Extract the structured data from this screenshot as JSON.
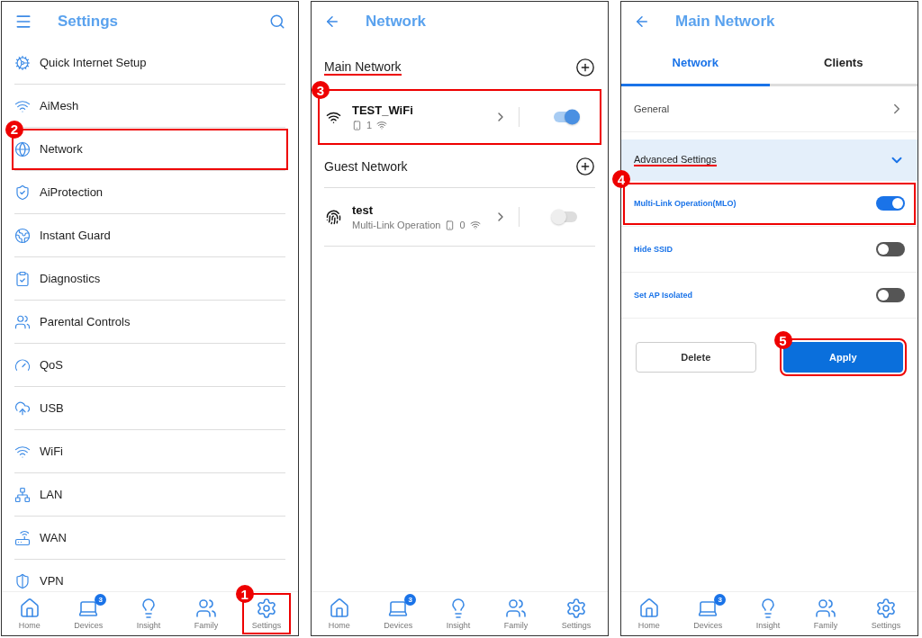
{
  "screens": [
    {
      "kind": "menu",
      "title": "Settings",
      "items": [
        {
          "label": "Quick Internet Setup"
        },
        {
          "label": "AiMesh"
        },
        {
          "label": "Network",
          "callout": "2"
        },
        {
          "label": "AiProtection"
        },
        {
          "label": "Instant Guard"
        },
        {
          "label": "Diagnostics"
        },
        {
          "label": "Parental Controls"
        },
        {
          "label": "QoS"
        },
        {
          "label": "USB"
        },
        {
          "label": "WiFi"
        },
        {
          "label": "LAN"
        },
        {
          "label": "WAN"
        },
        {
          "label": "VPN"
        }
      ],
      "nav": [
        {
          "label": "Home"
        },
        {
          "label": "Devices",
          "badge": "3"
        },
        {
          "label": "Insight"
        },
        {
          "label": "Family"
        },
        {
          "label": "Settings",
          "callout": "1"
        }
      ]
    },
    {
      "kind": "networks",
      "title": "Network",
      "sections": [
        {
          "title": "Main Network",
          "underlined": true,
          "networks": [
            {
              "name": "TEST_WiFi",
              "clients": "1",
              "on": true,
              "callout": "3"
            }
          ]
        },
        {
          "title": "Guest Network",
          "underlined": false,
          "networks": [
            {
              "name": "test",
              "subtitle": "Multi-Link Operation",
              "clients": "0",
              "on": false
            }
          ]
        }
      ],
      "nav": [
        {
          "label": "Home"
        },
        {
          "label": "Devices",
          "badge": "3"
        },
        {
          "label": "Insight"
        },
        {
          "label": "Family"
        },
        {
          "label": "Settings"
        }
      ]
    },
    {
      "kind": "detail",
      "title": "Main Network",
      "tabs": [
        {
          "label": "Network",
          "selected": true
        },
        {
          "label": "Clients",
          "selected": false
        }
      ],
      "general": "General",
      "advanced": {
        "label": "Advanced Settings",
        "underlined": true,
        "expanded": true
      },
      "toggles": [
        {
          "label": "Multi-Link Operation(MLO)",
          "on": true,
          "callout": "4"
        },
        {
          "label": "Hide SSID",
          "on": false
        },
        {
          "label": "Set AP Isolated",
          "on": false
        }
      ],
      "buttons": [
        {
          "label": "Delete",
          "primary": false
        },
        {
          "label": "Apply",
          "primary": true,
          "callout": "5"
        }
      ],
      "nav": [
        {
          "label": "Home"
        },
        {
          "label": "Devices",
          "badge": "3"
        },
        {
          "label": "Insight"
        },
        {
          "label": "Family"
        },
        {
          "label": "Settings"
        }
      ]
    }
  ]
}
